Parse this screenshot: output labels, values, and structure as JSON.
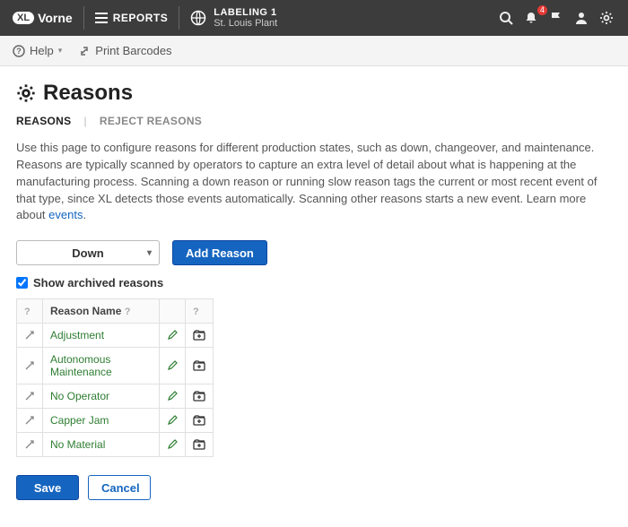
{
  "nav": {
    "brand_xl": "XL",
    "brand_name": "Vorne",
    "reports": "REPORTS",
    "plant_line": "LABELING 1",
    "plant_site": "St. Louis Plant",
    "notif_count": "4"
  },
  "subnav": {
    "help": "Help",
    "print": "Print Barcodes"
  },
  "page": {
    "title": "Reasons",
    "tab_reasons": "REASONS",
    "tab_reject": "REJECT REASONS",
    "desc_a": "Use this page to configure reasons for different production states, such as down, changeover, and maintenance. Reasons are typically scanned by operators to capture an extra level of detail about what is happening at the manufacturing process. Scanning a down reason or running slow reason tags the current or most recent event of that type, since XL detects those events automatically. Scanning other reasons starts a new event. Learn more about ",
    "desc_link": "events",
    "desc_b": "."
  },
  "toolbar": {
    "state": "Down",
    "add": "Add Reason",
    "show_archived": "Show archived reasons"
  },
  "table": {
    "col_name": "Reason Name",
    "rows": [
      {
        "name": "Adjustment"
      },
      {
        "name": "Autonomous Maintenance"
      },
      {
        "name": "No Operator"
      },
      {
        "name": "Capper Jam"
      },
      {
        "name": "No Material"
      }
    ]
  },
  "footer": {
    "save": "Save",
    "cancel": "Cancel"
  }
}
